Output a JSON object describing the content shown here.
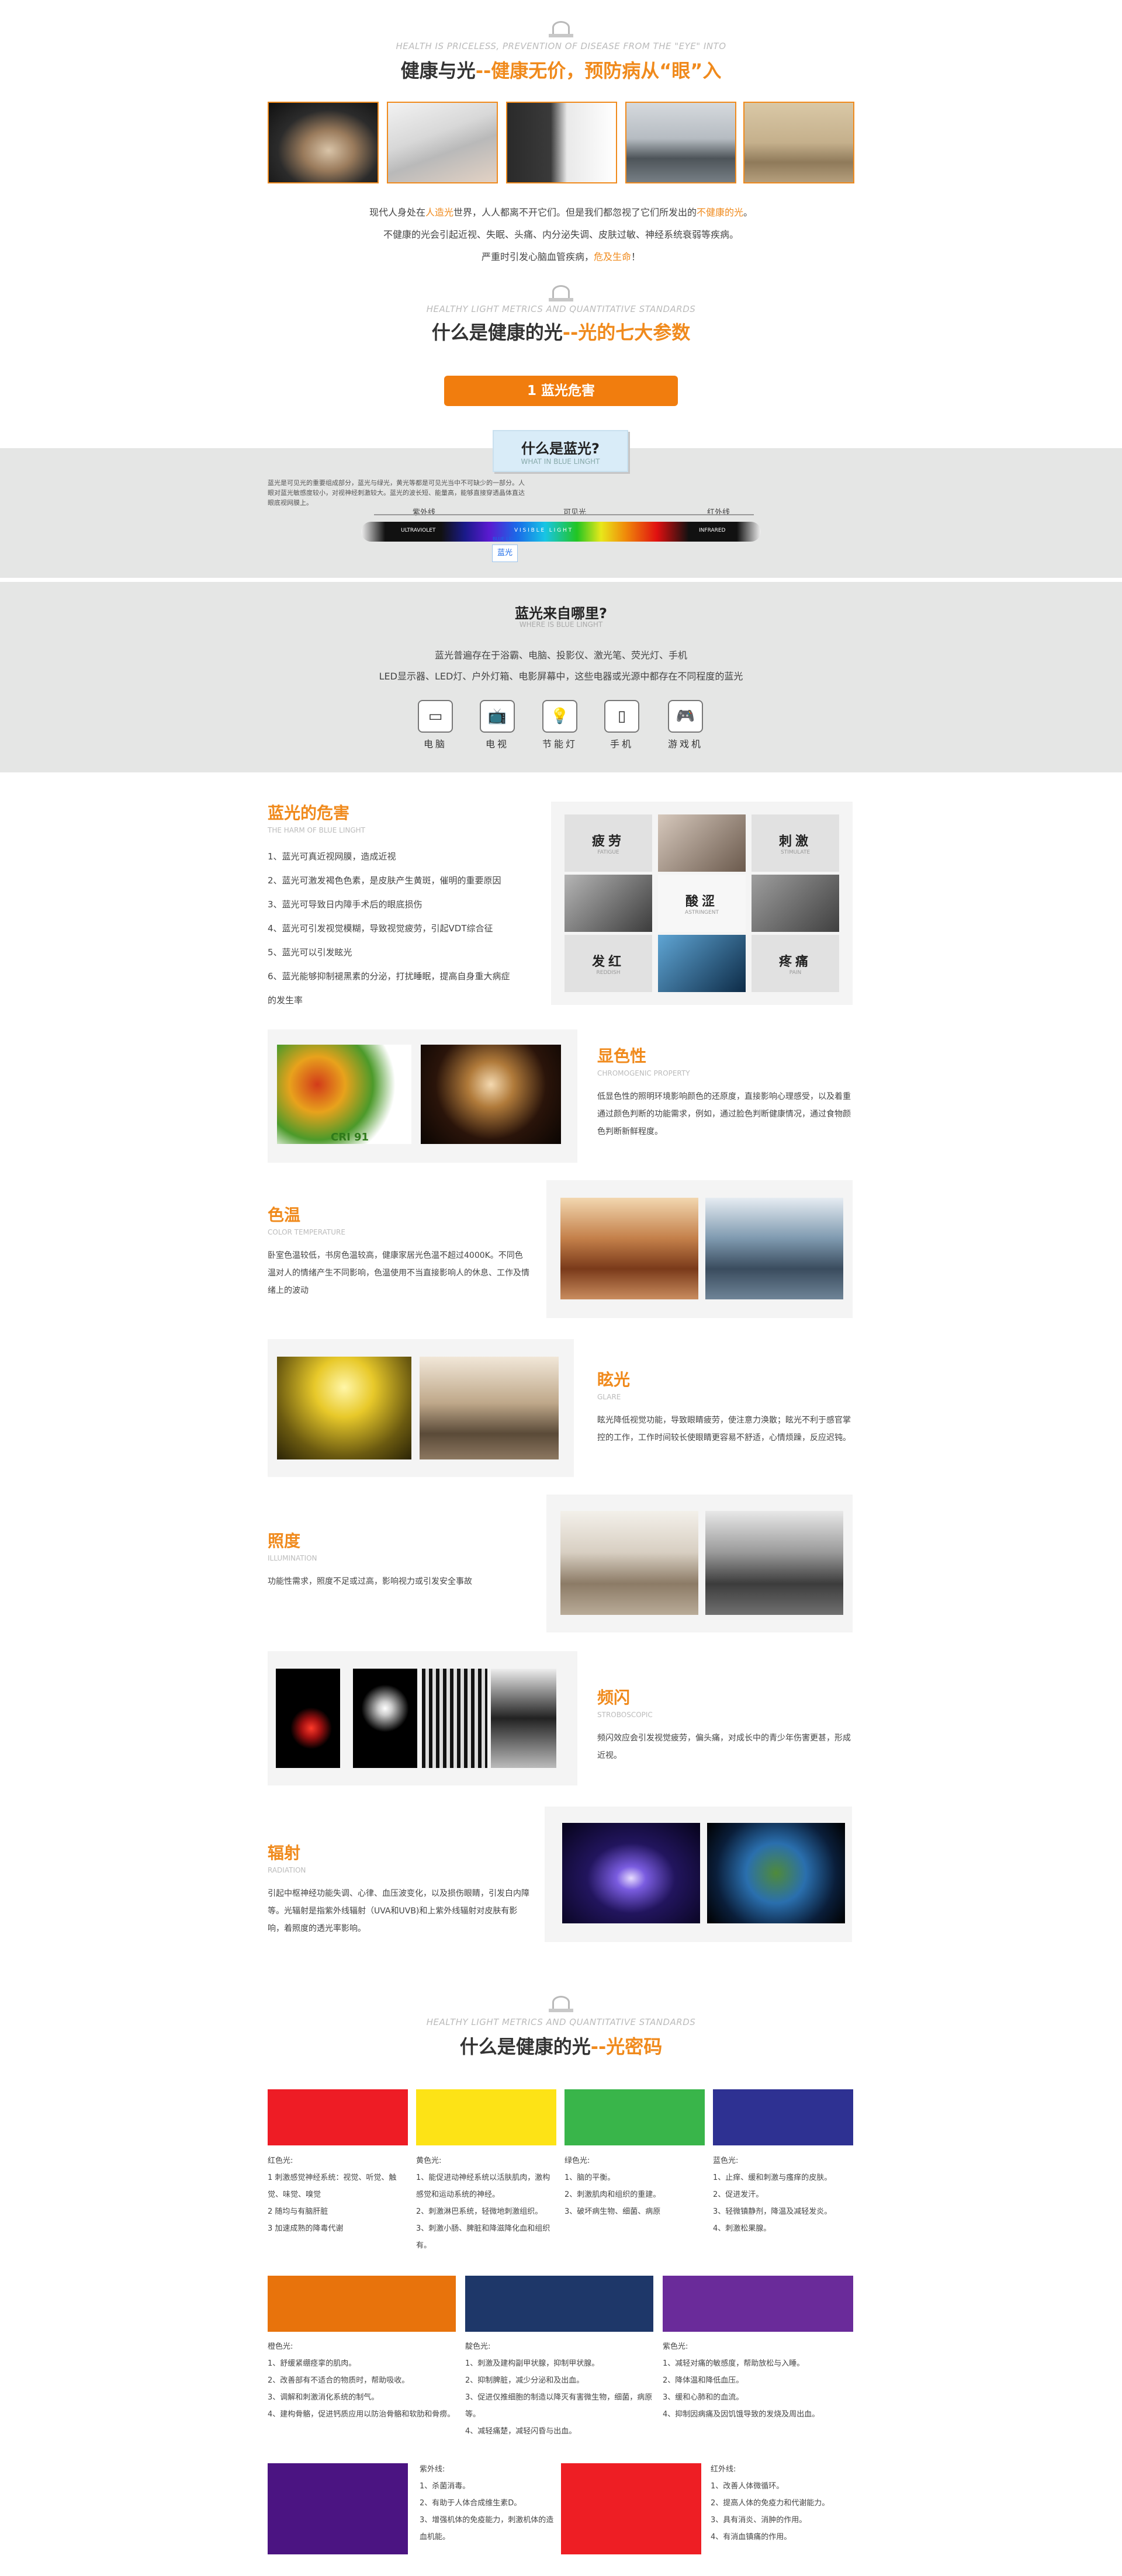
{
  "header": {
    "en_subtitle": "HEALTH IS PRICELESS, PREVENTION OF DISEASE FROM THE \"EYE\" INTO",
    "title_black": "健康与光",
    "title_sep": "--",
    "title_orange": "健康无价，预防病从“眼”入"
  },
  "intro": {
    "line1_a": "现代人身处在",
    "line1_b": "人造光",
    "line1_c": "世界，人人都离不开它们。但是我们都忽视了它们所发出的",
    "line1_d": "不健康的光",
    "line1_e": "。",
    "line2": "不健康的光会引起近视、失眠、头痛、内分泌失调、皮肤过敏、神经系统衰弱等疾病。",
    "line3_a": "严重时引发心脑血管疾病，",
    "line3_b": "危及生命",
    "line3_c": "！"
  },
  "params": {
    "en_subtitle": "HEALTHY LIGHT METRICS AND QUANTITATIVE STANDARDS",
    "title_black": "什么是健康的光",
    "title_sep": "--",
    "title_orange": "光的七大参数",
    "button": "1 蓝光危害"
  },
  "bluelight": {
    "chip_title": "什么是蓝光?",
    "chip_en": "WHAT IN BLUE LINGHT",
    "desc": "蓝光是可见光的重要组成部分，蓝光与绿光，黄光等都是可见光当中不可缺少的一部分。人眼对蓝光敏感度较小，对视神经刺激较大。蓝光的波长短、能量高，能够直接穿透晶体直达眼底视网膜上。",
    "label_uv": "紫外线",
    "label_visible": "可见光",
    "label_ir": "红外线",
    "label_uv_en": "ULTRAVIOLET",
    "label_visible_en": "V I S I B L E   L I G H T",
    "label_ir_en": "INFRARED",
    "label_blue_en": "BLUE LIGHT",
    "label_blue": "蓝光"
  },
  "source": {
    "title": "蓝光来自哪里?",
    "en": "WHERE IS BLUE LINGHT",
    "line1": "蓝光普遍存在于浴霸、电脑、投影仪、激光笔、荧光灯、手机",
    "line2": "LED显示器、LED灯、户外灯箱、电影屏幕中，这些电器或光源中都存在不同程度的蓝光",
    "devices": [
      {
        "label": "电脑",
        "icon": "monitor-icon"
      },
      {
        "label": "电视",
        "icon": "tv-icon"
      },
      {
        "label": "节能灯",
        "icon": "bulb-icon"
      },
      {
        "label": "手机",
        "icon": "phone-icon"
      },
      {
        "label": "游戏机",
        "icon": "gamepad-icon"
      }
    ]
  },
  "harm": {
    "title": "蓝光的危害",
    "en": "THE HARM OF BLUE LINGHT",
    "items": [
      "1、蓝光可真近视网膜，造成近视",
      "2、蓝光可激发褐色色素，是皮肤产生黄斑，催明的重要原因",
      "3、蓝光可导致日内障手术后的眼底损伤",
      "4、蓝光可引发视觉模糊，导致视觉疲劳，引起VDT综合征",
      "5、蓝光可以引发眩光",
      "6、蓝光能够抑制褪黑素的分泌，打扰睡眠，提高自身重大病症",
      "的发生率"
    ],
    "grid": [
      {
        "cn": "疲劳",
        "en": "FATIGUE"
      },
      {
        "cn": "刺激",
        "en": "STIMULATE"
      },
      {
        "cn": "酸涩",
        "en": "ASTRINGENT"
      },
      {
        "cn": "发红",
        "en": "REDDISH"
      },
      {
        "cn": "疼痛",
        "en": "PAIN"
      }
    ]
  },
  "features": [
    {
      "key": "cri",
      "title": "显色性",
      "en": "CHROMOGENIC PROPERTY",
      "text": "低显色性的照明环境影响颜色的还原度，直接影响心理感受，以及着重通过颜色判断的功能需求，例如，通过脸色判断健康情况，通过食物颜色判断新鲜程度。",
      "badge": "CRI 91"
    },
    {
      "key": "cct",
      "title": "色温",
      "en": "COLOR TEMPERATURE",
      "text": "卧室色温较低，书房色温较高，健康家居光色温不超过4000K。不同色温对人的情绪产生不同影响，色温使用不当直接影响人的休息、工作及情绪上的波动"
    },
    {
      "key": "glare",
      "title": "眩光",
      "en": "GLARE",
      "text": "眩光降低视觉功能，导致眼睛疲劳，使注意力涣散；眩光不利于感官掌控的工作，工作时间较长使眼睛更容易不舒适，心情烦躁，反应迟钝。"
    },
    {
      "key": "illum",
      "title": "照度",
      "en": "ILLUMINATION",
      "text": "功能性需求，照度不足或过高，影响视力或引发安全事故"
    },
    {
      "key": "flicker",
      "title": "频闪",
      "en": "STROBOSCOPIC",
      "text": "频闪效应会引发视觉疲劳，偏头痛，对成长中的青少年伤害更甚，形成近视。"
    },
    {
      "key": "radiation",
      "title": "辐射",
      "en": "RADIATION",
      "text": "引起中枢神经功能失调、心律、血压波变化，以及损伤眼睛，引发白内障等。光辐射是指紫外线辐射（UVA和UVB)和上紫外线辐射对皮肤有影响，着照度的透光率影响。"
    }
  ],
  "codes": {
    "en_subtitle": "HEALTHY LIGHT METRICS AND QUANTITATIVE STANDARDS",
    "title_black": "什么是健康的光",
    "title_sep": "--",
    "title_orange": "光密码",
    "colors": [
      {
        "name": "红色光:",
        "hex": "#ee1c25",
        "lines": [
          "1 刺激感觉神经系统：视觉、听觉、触觉、味觉、嗅觉",
          "2 随均与有脑肝脏",
          "3 加速成熟的降毒代谢"
        ]
      },
      {
        "name": "黄色光:",
        "hex": "#fde316",
        "lines": [
          "1、能促进动神经系统以活肤肌肉，激构感觉和运动系统的神经。",
          "2、刺激淋巴系统，轻微地刺激组织。",
          "3、刺激小肠、脾脏和降滋降化血和组织有。"
        ]
      },
      {
        "name": "绿色光:",
        "hex": "#39b54a",
        "lines": [
          "1、脑的平衡。",
          "2、刺激肌肉和组织的重建。",
          "3、破坏病生物、细菌、病原"
        ]
      },
      {
        "name": "蓝色光:",
        "hex": "#2e3192",
        "lines": [
          "1、止痒、缓和刺激与瘙痒的皮肤。",
          "2、促进发汗。",
          "3、轻微镇静剂，降温及减轻发炎。",
          "4、刺激松果腺。"
        ]
      },
      {
        "name": "橙色光:",
        "hex": "#e8730c",
        "lines": [
          "1、舒缓紧绷痉挛的肌肉。",
          "2、改善部有不适合的物质时，帮助吸收。",
          "3、调解和刺激消化系统的制气。",
          "4、建构骨骼，促进钙质应用以防治骨骼和软肋和骨痨。"
        ]
      },
      {
        "name": "靛色光:",
        "hex": "#1e3769",
        "lines": [
          "1、刺激及建构副甲状腺，抑制甲状腺。",
          "2、抑制脾脏，减少分泌和及出血。",
          "3、促进仅推细胞的制造以降灭有害微生物，细菌，病原等。",
          "4、减轻痛楚，减轻闪昏与出血。"
        ]
      },
      {
        "name": "紫色光:",
        "hex": "#6a2b9a",
        "lines": [
          "1、减轻对痛的敏感度，帮助放松与入睡。",
          "2、降体温和降低血压。",
          "3、缓和心肺和的血流。",
          "4、抑制因病痛及因饥饿导致的发烧及周出血。"
        ]
      },
      {
        "name": "紫外线:",
        "hex": "#4b1482",
        "lines": [
          "1、杀菌消毒。",
          "2、有助于人体合成维生素D。",
          "3、增强机体的免疫能力，刺激机体的造血机能。"
        ]
      },
      {
        "name": "红外线:",
        "hex": "#ee1e24",
        "lines": [
          "1、改善人体微循环。",
          "2、提高人体的免疫力和代谢能力。",
          "3、具有消炎、消肿的作用。",
          "4、有消血镇痛的作用。"
        ]
      }
    ]
  }
}
